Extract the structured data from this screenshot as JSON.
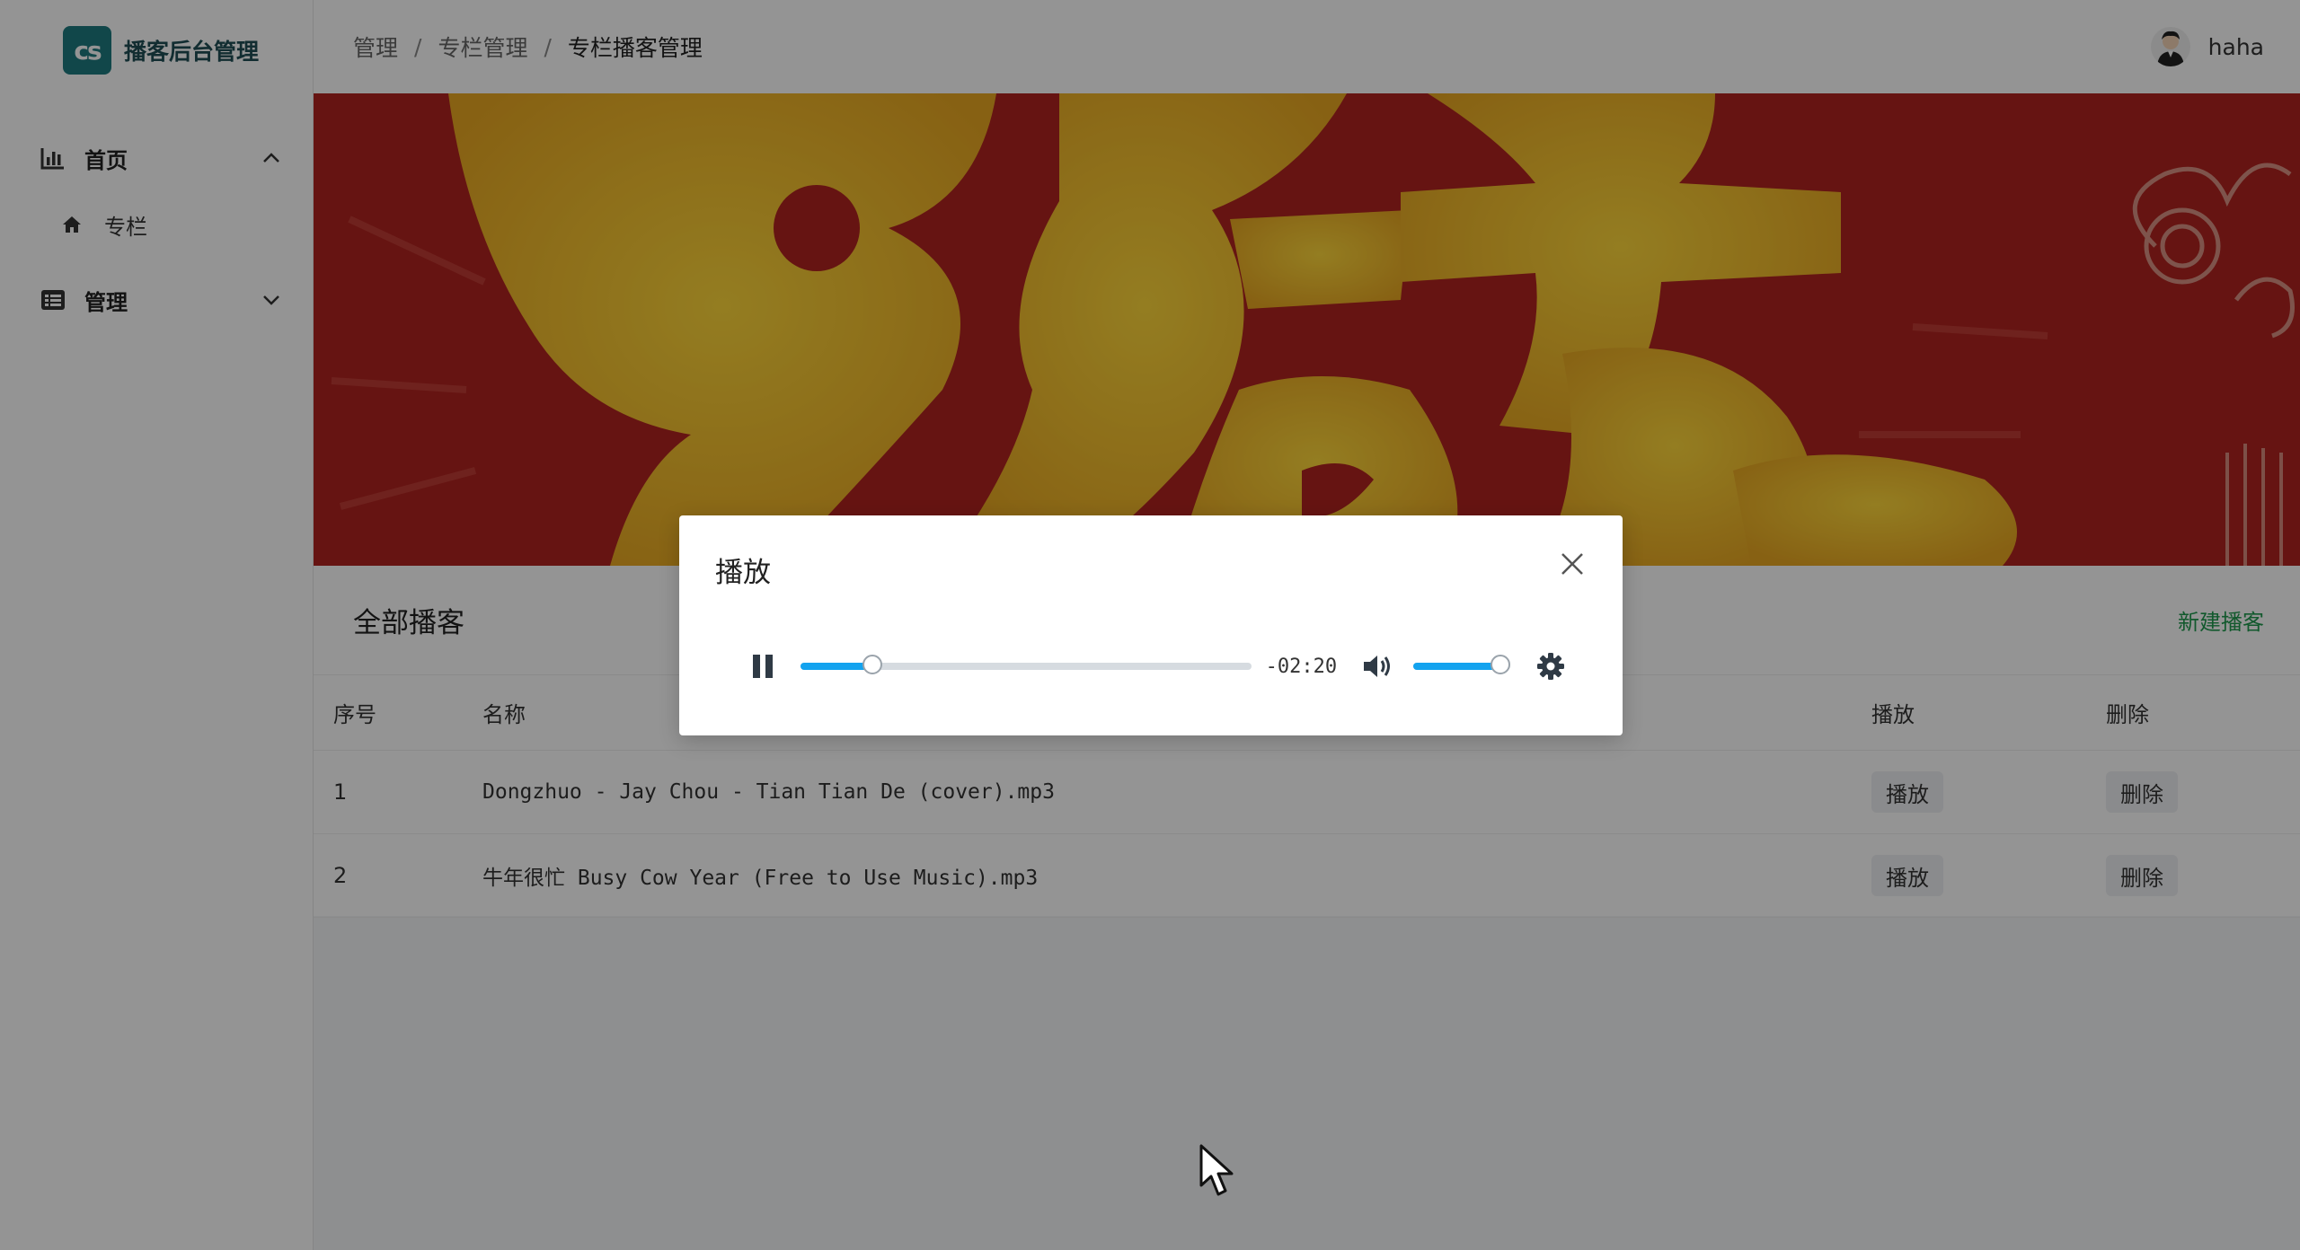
{
  "app": {
    "logo_text": "播客后台管理",
    "logo_badge": "cs"
  },
  "sidebar": {
    "groups": [
      {
        "label": "首页",
        "icon": "bar-chart-icon",
        "expanded": true,
        "children": [
          {
            "label": "专栏",
            "icon": "home-icon"
          }
        ]
      },
      {
        "label": "管理",
        "icon": "list-icon",
        "expanded": false
      }
    ]
  },
  "header": {
    "breadcrumb": [
      "管理",
      "专栏管理",
      "专栏播客管理"
    ],
    "separator": "/",
    "username": "haha"
  },
  "card": {
    "title": "全部播客",
    "action": "新建播客",
    "columns": {
      "index": "序号",
      "name": "名称",
      "play": "播放",
      "delete": "删除"
    },
    "rows": [
      {
        "index": "1",
        "name": "Dongzhuo - Jay Chou - Tian Tian De (cover).mp3",
        "play": "播放",
        "delete": "删除"
      },
      {
        "index": "2",
        "name": "牛年很忙 Busy Cow Year (Free to Use Music).mp3",
        "play": "播放",
        "delete": "删除"
      }
    ]
  },
  "modal": {
    "title": "播放",
    "player": {
      "state": "playing",
      "remaining_time": "-02:20",
      "progress_fraction": 0.16,
      "volume_fraction": 0.9
    }
  },
  "colors": {
    "accent": "#13a3ef",
    "link_green": "#1f9a4f",
    "banner_red": "#b5241f",
    "banner_gold": "#f2c230",
    "logo": "#1e7b80"
  }
}
